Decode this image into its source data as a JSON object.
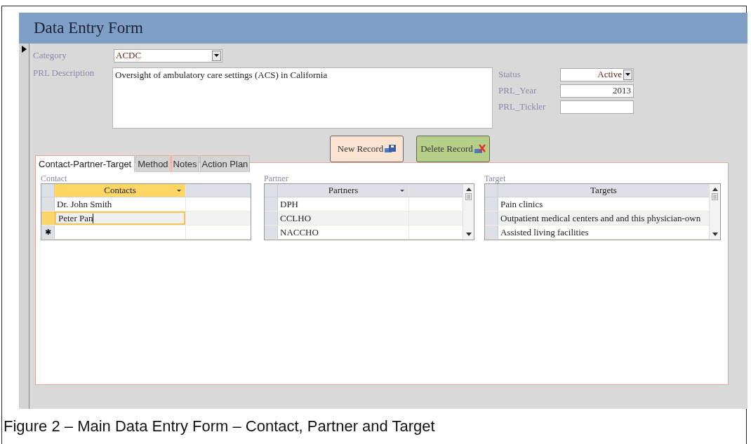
{
  "form_title": "Data Entry Form",
  "record_selector": {
    "current": true
  },
  "fields": {
    "category": {
      "label": "Category",
      "value": "ACDC"
    },
    "description": {
      "label": "PRL Description",
      "value": "Oversight of ambulatory care settings (ACS) in California"
    },
    "status": {
      "label": "Status",
      "value": "Active"
    },
    "prl_year": {
      "label": "PRL_Year",
      "value": "2013"
    },
    "prl_tickler": {
      "label": "PRL_Tickler"
    }
  },
  "buttons": [
    {
      "label": "New Record",
      "kind": "new"
    },
    {
      "label": "Delete Record",
      "kind": "delete"
    }
  ],
  "tabs": [
    {
      "label": "Contact-Partner-Target",
      "selected": true
    },
    {
      "label": "Method",
      "selected": false
    },
    {
      "label": "Notes",
      "selected": false
    },
    {
      "label": "Action Plan",
      "selected": false
    }
  ],
  "grids": [
    {
      "label": "Contact",
      "header": "Contacts",
      "header_dropdown": true,
      "focused": true,
      "scrollbar": false,
      "new_row_marker": "✱",
      "rows": [
        {
          "text": "Dr. John Smith",
          "selected": false
        },
        {
          "text": "Peter Pan",
          "selected": true
        }
      ]
    },
    {
      "label": "Partner",
      "header": "Partners",
      "header_dropdown": true,
      "focused": false,
      "scrollbar": true,
      "rows": [
        {
          "text": "DPH",
          "selected": false
        },
        {
          "text": "CCLHO",
          "selected": false
        },
        {
          "text": "NACCHO",
          "selected": false
        }
      ]
    },
    {
      "label": "Target",
      "header": "Targets",
      "header_dropdown": false,
      "focused": false,
      "scrollbar": true,
      "rows": [
        {
          "text": "Pain clinics",
          "selected": false
        },
        {
          "text": "Outpatient medical centers and and this physician-own",
          "selected": false
        },
        {
          "text": "Assisted living facilities",
          "selected": false
        }
      ]
    }
  ],
  "caption": "Figure 2 – Main Data Entry Form – Contact, Partner and Target"
}
